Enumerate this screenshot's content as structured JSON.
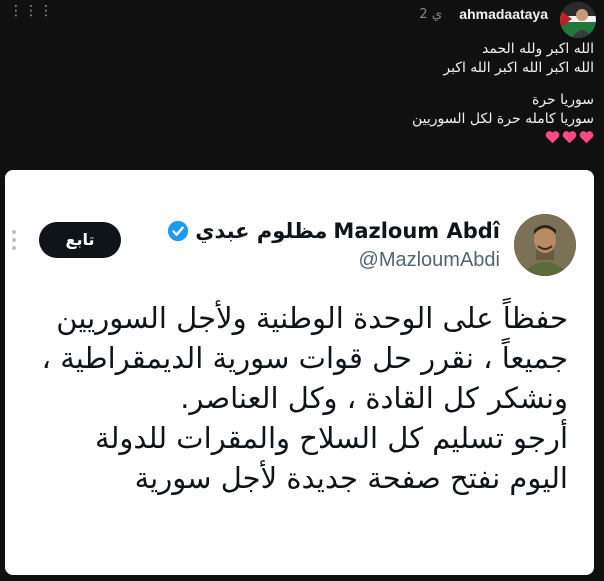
{
  "header": {
    "menu_icon": "more-dots-icon",
    "timestamp": "2 ي",
    "username": "ahmadaataya"
  },
  "caption": {
    "lines": [
      "الله اكبر ولله الحمد",
      "الله اكبر الله اكبر الله اكبر",
      "سوريا حرة",
      "سوريا كامله حرة لكل السوريين"
    ],
    "heart_icons": [
      "heart-icon",
      "heart-icon",
      "heart-icon"
    ],
    "heart_color": "#ff4a8a"
  },
  "tweet": {
    "name_latin": "Mazloum Abdî",
    "name_arabic": "مظلوم عبدي",
    "handle": "@MazloumAbdi",
    "follow_label": "تابع",
    "verified_color": "#1d9bf0",
    "body_lines": [
      "حفظاً على الوحدة الوطنية ولأجل السوريين",
      "جميعاً ، نقرر حل قوات سورية الديمقراطية ،",
      "ونشكر كل القادة ، وكل العناصر.",
      "أرجو تسليم كل السلاح والمقرات للدولة",
      "اليوم نفتح صفحة جديدة لأجل سورية"
    ]
  }
}
